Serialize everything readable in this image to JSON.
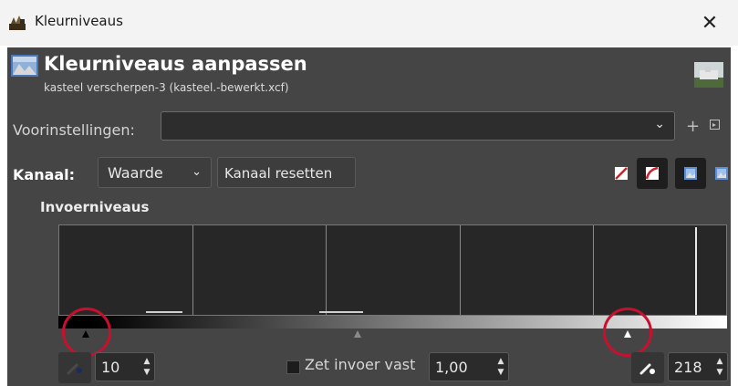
{
  "window": {
    "title": "Kleurniveaus",
    "close_icon": "close-icon"
  },
  "header": {
    "title": "Kleurniveaus aanpassen",
    "subtitle": "kasteel verscherpen-3 (kasteel.-bewerkt.xcf)"
  },
  "presets": {
    "label": "Voorinstellingen:",
    "value": ""
  },
  "channel": {
    "label": "Kanaal:",
    "selected": "Waarde",
    "reset_label": "Kanaal resetten"
  },
  "input_levels": {
    "title": "Invoerniveaus",
    "low": "10",
    "gamma_label": "Zet invoer vast",
    "gamma": "1,00",
    "high": "218"
  },
  "colors": {
    "panel": "#454545",
    "highlight_circle": "#c8102e",
    "titlebar": "#f3f3f3"
  }
}
